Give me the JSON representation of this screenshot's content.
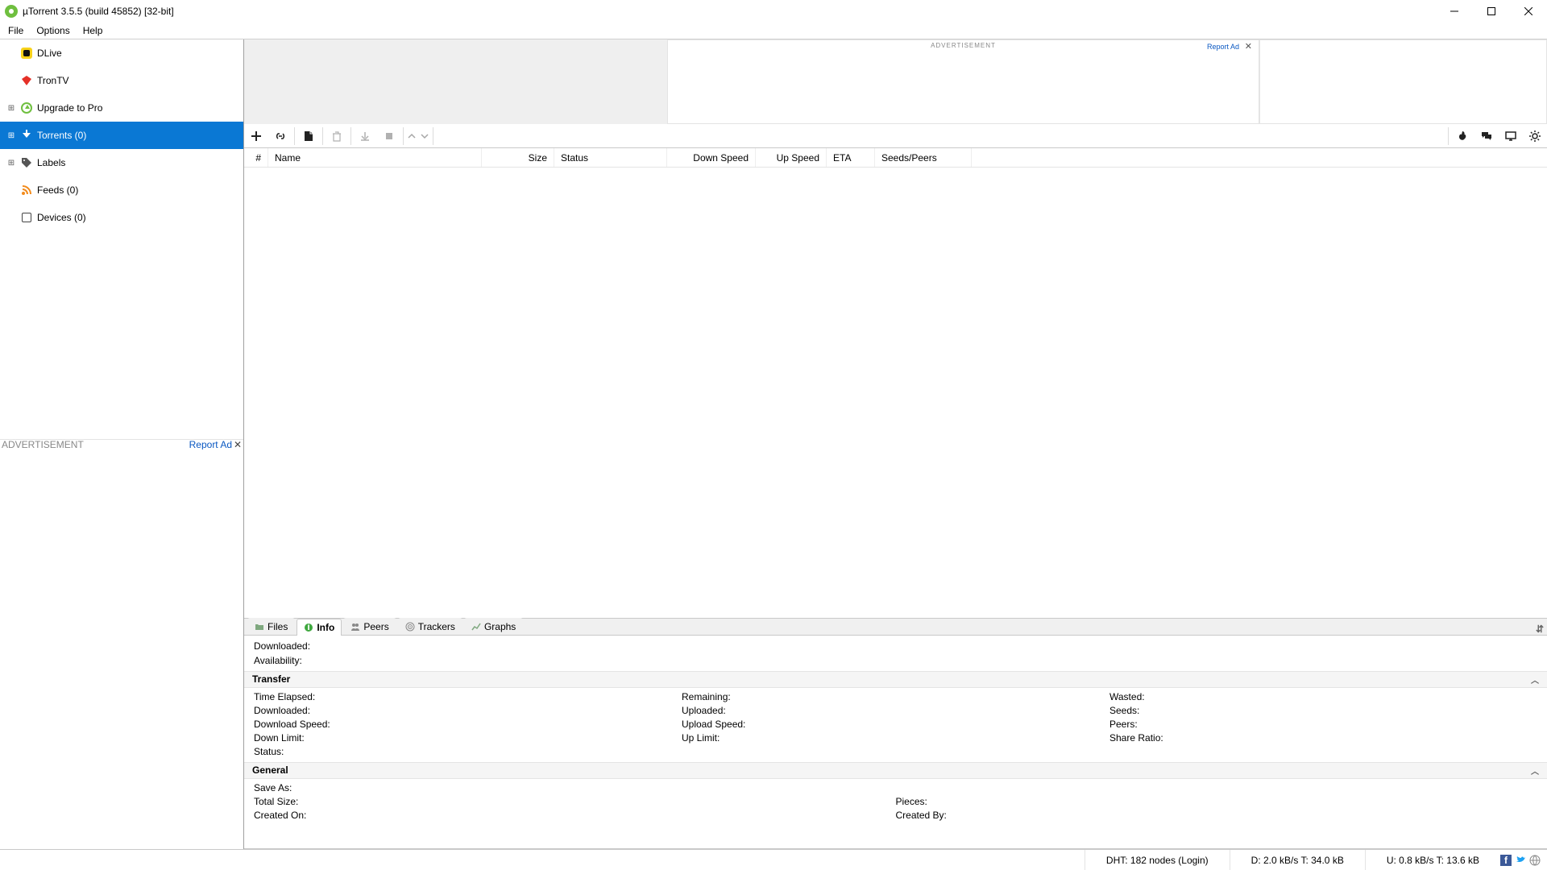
{
  "window": {
    "title": "µTorrent 3.5.5  (build 45852) [32-bit]"
  },
  "menu": {
    "file": "File",
    "options": "Options",
    "help": "Help"
  },
  "sidebar": {
    "items": [
      {
        "label": "DLive"
      },
      {
        "label": "TronTV"
      },
      {
        "label": "Upgrade to Pro"
      },
      {
        "label": "Torrents (0)"
      },
      {
        "label": "Labels"
      },
      {
        "label": "Feeds (0)"
      },
      {
        "label": "Devices (0)"
      }
    ],
    "ad": {
      "label": "ADVERTISEMENT",
      "report": "Report Ad"
    }
  },
  "ad_top": {
    "label": "ADVERTISEMENT",
    "report": "Report Ad"
  },
  "columns": {
    "num": "#",
    "name": "Name",
    "size": "Size",
    "status": "Status",
    "down": "Down Speed",
    "up": "Up Speed",
    "eta": "ETA",
    "seeds": "Seeds/Peers"
  },
  "tabs": {
    "files": "Files",
    "info": "Info",
    "peers": "Peers",
    "trackers": "Trackers",
    "graphs": "Graphs"
  },
  "detail": {
    "downloaded": "Downloaded:",
    "availability": "Availability:",
    "transfer_head": "Transfer",
    "transfer": {
      "time_elapsed": "Time Elapsed:",
      "downloaded": "Downloaded:",
      "download_speed": "Download Speed:",
      "down_limit": "Down Limit:",
      "status": "Status:",
      "remaining": "Remaining:",
      "uploaded": "Uploaded:",
      "upload_speed": "Upload Speed:",
      "up_limit": "Up Limit:",
      "wasted": "Wasted:",
      "seeds": "Seeds:",
      "peers": "Peers:",
      "share_ratio": "Share Ratio:"
    },
    "general_head": "General",
    "general": {
      "save_as": "Save As:",
      "total_size": "Total Size:",
      "created_on": "Created On:",
      "pieces": "Pieces:",
      "created_by": "Created By:"
    }
  },
  "status": {
    "dht": "DHT: 182 nodes (Login)",
    "down": "D: 2.0 kB/s T: 34.0 kB",
    "up": "U: 0.8 kB/s T: 13.6 kB"
  }
}
